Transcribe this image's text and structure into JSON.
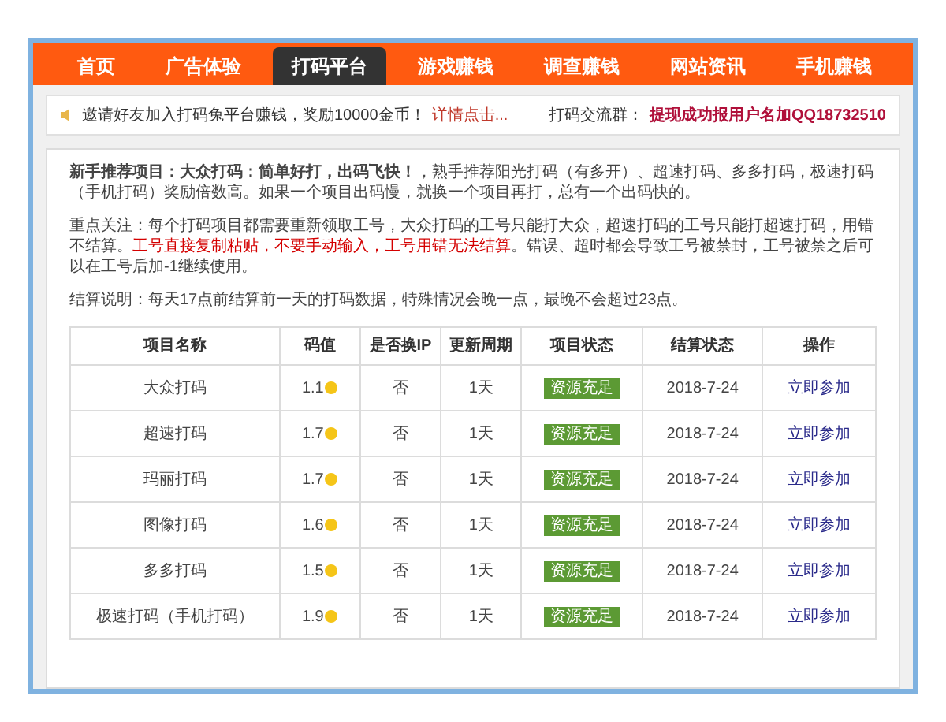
{
  "nav": [
    {
      "label": "首页",
      "selected": false
    },
    {
      "label": "广告体验",
      "selected": false
    },
    {
      "label": "打码平台",
      "selected": true
    },
    {
      "label": "游戏赚钱",
      "selected": false
    },
    {
      "label": "调查赚钱",
      "selected": false
    },
    {
      "label": "网站资讯",
      "selected": false
    },
    {
      "label": "手机赚钱",
      "selected": false
    }
  ],
  "notice": {
    "text": "邀请好友加入打码兔平台赚钱，奖励10000金币！",
    "link": "详情点击...",
    "group_label": "打码交流群：",
    "group_text": "提现成功报用户名加QQ18732510"
  },
  "intro": [
    {
      "parts": [
        {
          "kind": "plain",
          "text": "**新手推荐项目：大众打码：简单好打，出码飞快！**，熟手推荐阳光打码（有多开）、超速打码、多多打码，极速打码（手机打码）奖励倍数高。如果一个项目出码慢，就换一个项目再打，总有一个出码快的。"
        }
      ]
    },
    {
      "parts": [
        {
          "kind": "plain",
          "text": "重点关注：每个打码项目都需要重新领取工号，大众打码的工号只能打大众，超速打码的工号只能打超速打码，用错不结算。"
        },
        {
          "kind": "alert",
          "text": "工号直接复制粘贴，不要手动输入，工号用错无法结算"
        },
        {
          "kind": "plain",
          "text": "。错误、超时都会导致工号被禁封，工号被禁之后可以在工号后加-1继续使用。"
        }
      ]
    },
    {
      "parts": [
        {
          "kind": "plain",
          "text": "结算说明：每天17点前结算前一天的打码数据，特殊情况会晚一点，最晚不会超过23点。"
        }
      ]
    }
  ],
  "table": {
    "columns": [
      "项目名称",
      "码值",
      "是否换IP",
      "更新周期",
      "项目状态",
      "结算状态",
      "操作"
    ],
    "rows": [
      {
        "name": "大众打码",
        "value": "1.1",
        "change_ip": "否",
        "period": "1天",
        "status": "资源充足",
        "settle": "2018-7-24",
        "action": "立即参加"
      },
      {
        "name": "超速打码",
        "value": "1.7",
        "change_ip": "否",
        "period": "1天",
        "status": "资源充足",
        "settle": "2018-7-24",
        "action": "立即参加"
      },
      {
        "name": "玛丽打码",
        "value": "1.7",
        "change_ip": "否",
        "period": "1天",
        "status": "资源充足",
        "settle": "2018-7-24",
        "action": "立即参加"
      },
      {
        "name": "图像打码",
        "value": "1.6",
        "change_ip": "否",
        "period": "1天",
        "status": "资源充足",
        "settle": "2018-7-24",
        "action": "立即参加"
      },
      {
        "name": "多多打码",
        "value": "1.5",
        "change_ip": "否",
        "period": "1天",
        "status": "资源充足",
        "settle": "2018-7-24",
        "action": "立即参加"
      },
      {
        "name": "极速打码（手机打码）",
        "value": "1.9",
        "change_ip": "否",
        "period": "1天",
        "status": "资源充足",
        "settle": "2018-7-24",
        "action": "立即参加"
      }
    ]
  }
}
